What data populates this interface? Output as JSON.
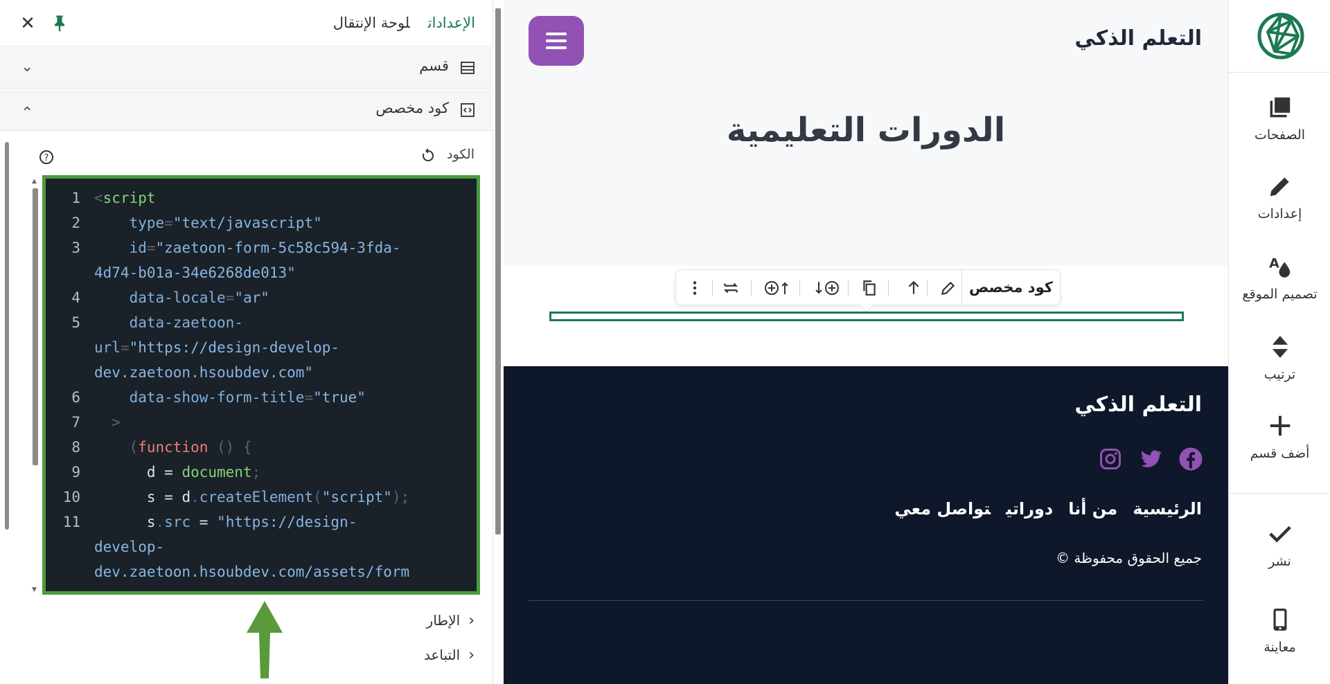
{
  "panel": {
    "tabs": {
      "settings": "الإعدادات",
      "navigation": "لوحة الإنتقال"
    },
    "section_accordion": "قسم",
    "custom_code_accordion": "كود مخصص",
    "code_label": "الكود",
    "frame_accordion": "الإطار",
    "spacing_accordion": "التباعد",
    "code_lines": [
      {
        "n": "1",
        "parts": [
          [
            "c-punc",
            "<"
          ],
          [
            "c-tag",
            "script"
          ]
        ]
      },
      {
        "n": "2",
        "parts": [
          [
            "c-attr",
            "    type"
          ],
          [
            "c-punc",
            "="
          ],
          [
            "c-str",
            "\"text/javascript\""
          ]
        ]
      },
      {
        "n": "3",
        "parts": [
          [
            "c-attr",
            "    id"
          ],
          [
            "c-punc",
            "="
          ],
          [
            "c-str",
            "\"zaetoon-form-5c58c594-3fda-"
          ]
        ]
      },
      {
        "n": "",
        "parts": [
          [
            "c-str",
            "4d74-b01a-34e6268de013\""
          ]
        ]
      },
      {
        "n": "4",
        "parts": [
          [
            "c-attr",
            "    data-locale"
          ],
          [
            "c-punc",
            "="
          ],
          [
            "c-str",
            "\"ar\""
          ]
        ]
      },
      {
        "n": "5",
        "parts": [
          [
            "c-attr",
            "    data-zaetoon-"
          ]
        ]
      },
      {
        "n": "",
        "parts": [
          [
            "c-attr",
            "url"
          ],
          [
            "c-punc",
            "="
          ],
          [
            "c-str",
            "\"https://design-develop-"
          ]
        ]
      },
      {
        "n": "",
        "parts": [
          [
            "c-str",
            "dev.zaetoon.hsoubdev.com\""
          ]
        ]
      },
      {
        "n": "6",
        "parts": [
          [
            "c-attr",
            "    data-show-form-title"
          ],
          [
            "c-punc",
            "="
          ],
          [
            "c-str",
            "\"true\""
          ]
        ]
      },
      {
        "n": "7",
        "parts": [
          [
            "c-punc",
            "  >"
          ]
        ]
      },
      {
        "n": "8",
        "parts": [
          [
            "c-punc",
            "    ("
          ],
          [
            "c-kw",
            "function"
          ],
          [
            "c-punc",
            " () {"
          ]
        ]
      },
      {
        "n": "9",
        "parts": [
          [
            "c-plain",
            "      d "
          ],
          [
            "c-plain",
            "= "
          ],
          [
            "c-tag",
            "document"
          ],
          [
            "c-punc",
            ";"
          ]
        ]
      },
      {
        "n": "10",
        "parts": [
          [
            "c-plain",
            "      s "
          ],
          [
            "c-plain",
            "= d"
          ],
          [
            "c-punc",
            "."
          ],
          [
            "c-fn",
            "createElement"
          ],
          [
            "c-punc",
            "("
          ],
          [
            "c-str",
            "\"script\""
          ],
          [
            "c-punc",
            ");"
          ]
        ]
      },
      {
        "n": "11",
        "parts": [
          [
            "c-plain",
            "      s"
          ],
          [
            "c-punc",
            "."
          ],
          [
            "c-fn",
            "src"
          ],
          [
            "c-plain",
            " = "
          ],
          [
            "c-str",
            "\"https://design-"
          ]
        ]
      },
      {
        "n": "",
        "parts": [
          [
            "c-str",
            "develop-"
          ]
        ]
      },
      {
        "n": "",
        "parts": [
          [
            "c-str",
            "dev.zaetoon.hsoubdev.com/assets/form"
          ]
        ]
      }
    ]
  },
  "preview": {
    "brand": "التعلم الذكي",
    "hero_title": "الدورات التعليمية",
    "toolbar_label": "كود مخصص",
    "footer": {
      "brand": "التعلم الذكي",
      "nav": [
        "الرئيسية",
        "من أنا",
        "دوراتي",
        "تواصل معي"
      ],
      "copyright": "جميع الحقوق محفوظة ©"
    },
    "colors": {
      "accent_purple": "#9152b3",
      "footer_bg": "#0f172a",
      "brand_green": "#1a7a50",
      "editor_border": "#4d9a3f"
    }
  },
  "rail": {
    "items": [
      {
        "label": "الصفحات",
        "icon": "pages-icon"
      },
      {
        "label": "إعدادات",
        "icon": "pencil-icon"
      },
      {
        "label": "تصميم الموقع",
        "icon": "design-icon"
      },
      {
        "label": "ترتيب",
        "icon": "sort-icon"
      },
      {
        "label": "أضف قسم",
        "icon": "plus-icon"
      },
      {
        "label": "نشر",
        "icon": "check-icon"
      },
      {
        "label": "معاينة",
        "icon": "mobile-icon"
      }
    ]
  }
}
